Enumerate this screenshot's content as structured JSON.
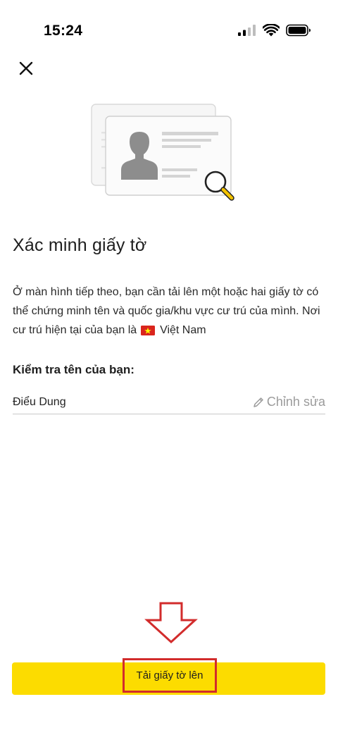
{
  "status_bar": {
    "time": "15:24",
    "icons": [
      "cellular-signal-icon",
      "wifi-icon",
      "battery-icon"
    ]
  },
  "header": {
    "close_icon": "close-icon"
  },
  "illustration": {
    "icon": "id-card-magnifier-illustration"
  },
  "main": {
    "title": "Xác minh giấy tờ",
    "description_part1": "Ở màn hình tiếp theo, bạn cần tải lên một hoặc hai giấy tờ có thể chứng minh tên và quốc gia/khu vực cư trú của mình. Nơi cư trú hiện tại của bạn là",
    "country_flag_icon": "vietnam-flag-icon",
    "country": "Việt Nam",
    "name_section_label": "Kiểm tra tên của bạn:",
    "name_value": "Điểu Dung",
    "edit_label": "Chỉnh sửa",
    "edit_icon": "pencil-icon"
  },
  "footer": {
    "upload_button_label": "Tải giấy tờ lên"
  },
  "colors": {
    "primary_button": "#fcdc00",
    "annotation_red": "#d22c2c",
    "muted_text": "#9b9b9b",
    "flag_red": "#da251d",
    "flag_star": "#ffff00"
  }
}
